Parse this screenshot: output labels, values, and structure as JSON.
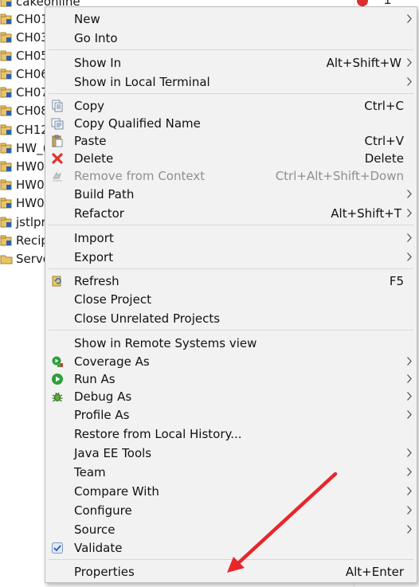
{
  "explorer": {
    "items": [
      {
        "label": "cakeonline",
        "icon": "project-icon"
      },
      {
        "label": "CH01",
        "icon": "project-icon"
      },
      {
        "label": "CH03",
        "icon": "project-icon"
      },
      {
        "label": "CH05",
        "icon": "project-icon"
      },
      {
        "label": "CH06",
        "icon": "project-icon"
      },
      {
        "label": "CH07",
        "icon": "project-icon"
      },
      {
        "label": "CH08",
        "icon": "project-icon"
      },
      {
        "label": "CH12",
        "icon": "project-icon"
      },
      {
        "label": "HW_(",
        "icon": "project-icon"
      },
      {
        "label": "HW0",
        "icon": "project-icon"
      },
      {
        "label": "HW0",
        "icon": "project-icon"
      },
      {
        "label": "HW0",
        "icon": "project-icon"
      },
      {
        "label": "jstlpr",
        "icon": "project-icon"
      },
      {
        "label": "Recip",
        "icon": "project-icon"
      },
      {
        "label": "Serve",
        "icon": "folder-icon"
      }
    ]
  },
  "background": {
    "right_digit": "1"
  },
  "menu": {
    "items": [
      {
        "label": "New",
        "shortcut": "",
        "submenu": true,
        "icon": ""
      },
      {
        "label": "Go Into",
        "shortcut": "",
        "submenu": false,
        "icon": ""
      },
      {
        "label": "Show In",
        "shortcut": "Alt+Shift+W",
        "submenu": true,
        "icon": ""
      },
      {
        "label": "Show in Local Terminal",
        "shortcut": "",
        "submenu": true,
        "icon": ""
      },
      {
        "label": "Copy",
        "shortcut": "Ctrl+C",
        "submenu": false,
        "icon": "copy-icon"
      },
      {
        "label": "Copy Qualified Name",
        "shortcut": "",
        "submenu": false,
        "icon": "copy-qualified-name-icon"
      },
      {
        "label": "Paste",
        "shortcut": "Ctrl+V",
        "submenu": false,
        "icon": "paste-icon"
      },
      {
        "label": "Delete",
        "shortcut": "Delete",
        "submenu": false,
        "icon": "delete-icon"
      },
      {
        "label": "Remove from Context",
        "shortcut": "Ctrl+Alt+Shift+Down",
        "submenu": false,
        "icon": "remove-from-context-icon",
        "disabled": true
      },
      {
        "label": "Build Path",
        "shortcut": "",
        "submenu": true,
        "icon": ""
      },
      {
        "label": "Refactor",
        "shortcut": "Alt+Shift+T",
        "submenu": true,
        "icon": ""
      },
      {
        "label": "Import",
        "shortcut": "",
        "submenu": true,
        "icon": ""
      },
      {
        "label": "Export",
        "shortcut": "",
        "submenu": true,
        "icon": ""
      },
      {
        "label": "Refresh",
        "shortcut": "F5",
        "submenu": false,
        "icon": "refresh-icon"
      },
      {
        "label": "Close Project",
        "shortcut": "",
        "submenu": false,
        "icon": ""
      },
      {
        "label": "Close Unrelated Projects",
        "shortcut": "",
        "submenu": false,
        "icon": ""
      },
      {
        "label": "Show in Remote Systems view",
        "shortcut": "",
        "submenu": false,
        "icon": ""
      },
      {
        "label": "Coverage As",
        "shortcut": "",
        "submenu": true,
        "icon": "coverage-icon"
      },
      {
        "label": "Run As",
        "shortcut": "",
        "submenu": true,
        "icon": "run-icon"
      },
      {
        "label": "Debug As",
        "shortcut": "",
        "submenu": true,
        "icon": "debug-icon"
      },
      {
        "label": "Profile As",
        "shortcut": "",
        "submenu": true,
        "icon": ""
      },
      {
        "label": "Restore from Local History...",
        "shortcut": "",
        "submenu": false,
        "icon": ""
      },
      {
        "label": "Java EE Tools",
        "shortcut": "",
        "submenu": true,
        "icon": ""
      },
      {
        "label": "Team",
        "shortcut": "",
        "submenu": true,
        "icon": ""
      },
      {
        "label": "Compare With",
        "shortcut": "",
        "submenu": true,
        "icon": ""
      },
      {
        "label": "Configure",
        "shortcut": "",
        "submenu": true,
        "icon": ""
      },
      {
        "label": "Source",
        "shortcut": "",
        "submenu": true,
        "icon": ""
      },
      {
        "label": "Validate",
        "shortcut": "",
        "submenu": false,
        "icon": "validate-check-icon"
      },
      {
        "label": "Properties",
        "shortcut": "Alt+Enter",
        "submenu": false,
        "icon": ""
      }
    ]
  },
  "colors": {
    "menu_background": "#f2f2f2",
    "annotation_arrow": "#e8262a",
    "delete_icon": "#e0342b",
    "run_icon": "#2e9e3a"
  }
}
